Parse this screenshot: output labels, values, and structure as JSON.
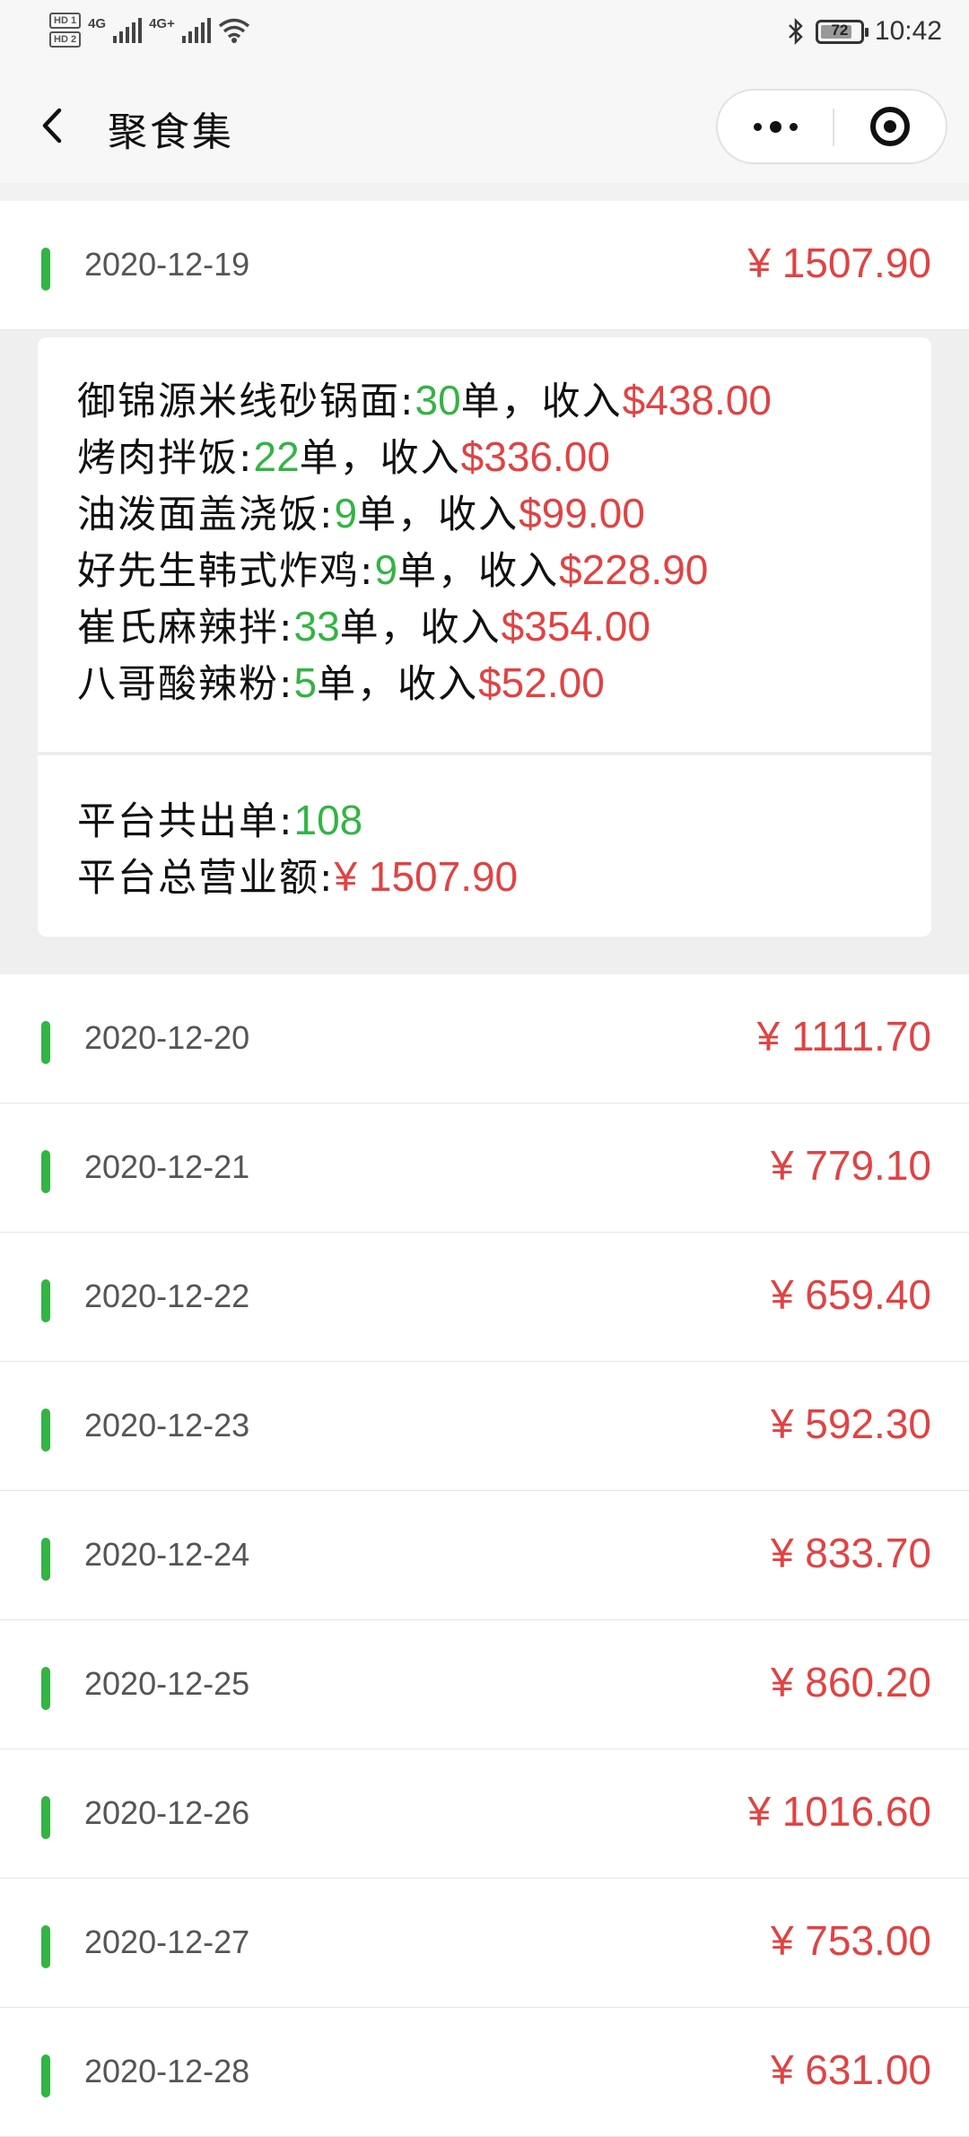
{
  "status_bar": {
    "hd1": "HD 1",
    "hd2": "HD 2",
    "net1": "4G",
    "net2": "4G+",
    "battery": "72",
    "time": "10:42"
  },
  "nav": {
    "title": "聚食集"
  },
  "days": [
    {
      "date": "2020-12-19",
      "amount": "¥ 1507.90",
      "expanded": true,
      "shops": [
        {
          "name": "御锦源米线砂锅面:",
          "orders": "30",
          "unit": "单，收入",
          "revenue": "$438.00"
        },
        {
          "name": "烤肉拌饭:",
          "orders": "22",
          "unit": "单，收入",
          "revenue": "$336.00"
        },
        {
          "name": "油泼面盖浇饭:",
          "orders": "9",
          "unit": "单，收入",
          "revenue": "$99.00"
        },
        {
          "name": "好先生韩式炸鸡:",
          "orders": "9",
          "unit": "单，收入",
          "revenue": "$228.90"
        },
        {
          "name": "崔氏麻辣拌:",
          "orders": "33",
          "unit": "单，收入",
          "revenue": "$354.00"
        },
        {
          "name": "八哥酸辣粉:",
          "orders": "5",
          "unit": "单，收入",
          "revenue": "$52.00"
        }
      ],
      "summary": {
        "orders_label": "平台共出单:",
        "orders_value": "108",
        "revenue_label": "平台总营业额:",
        "revenue_value": "¥ 1507.90"
      }
    },
    {
      "date": "2020-12-20",
      "amount": "¥ 1111.70"
    },
    {
      "date": "2020-12-21",
      "amount": "¥ 779.10"
    },
    {
      "date": "2020-12-22",
      "amount": "¥ 659.40"
    },
    {
      "date": "2020-12-23",
      "amount": "¥ 592.30"
    },
    {
      "date": "2020-12-24",
      "amount": "¥ 833.70"
    },
    {
      "date": "2020-12-25",
      "amount": "¥ 860.20"
    },
    {
      "date": "2020-12-26",
      "amount": "¥ 1016.60"
    },
    {
      "date": "2020-12-27",
      "amount": "¥ 753.00"
    },
    {
      "date": "2020-12-28",
      "amount": "¥ 631.00"
    }
  ],
  "colors": {
    "accent_green": "#33b443",
    "amount_red": "#e04343"
  },
  "icons": [
    "back-icon",
    "more-icon",
    "close-miniprogram-icon",
    "bluetooth-icon",
    "wifi-icon",
    "signal-icon",
    "battery-icon"
  ]
}
